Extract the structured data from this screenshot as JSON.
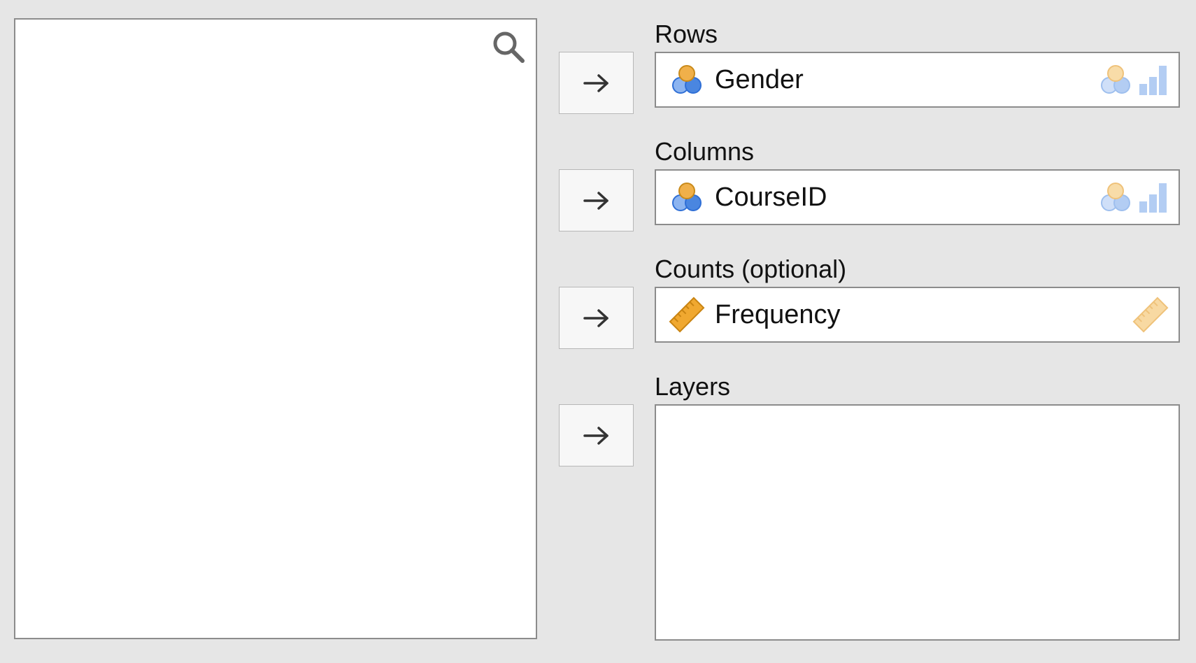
{
  "variable_list": {
    "search_icon": "search-icon"
  },
  "move_buttons": [
    {
      "icon": "arrow-right-icon"
    },
    {
      "icon": "arrow-right-icon"
    },
    {
      "icon": "arrow-right-icon"
    },
    {
      "icon": "arrow-right-icon"
    }
  ],
  "rows": {
    "label": "Rows",
    "variable": "Gender",
    "variable_icon": "nominal-icon",
    "accepts": [
      "nominal-icon",
      "ordinal-icon"
    ]
  },
  "columns": {
    "label": "Columns",
    "variable": "CourseID",
    "variable_icon": "nominal-icon",
    "accepts": [
      "nominal-icon",
      "ordinal-icon"
    ]
  },
  "counts": {
    "label": "Counts (optional)",
    "variable": "Frequency",
    "variable_icon": "continuous-icon",
    "accepts": [
      "continuous-icon"
    ]
  },
  "layers": {
    "label": "Layers"
  },
  "colors": {
    "background": "#e6e6e6",
    "nominal_orange": "#f0b04a",
    "nominal_blue": "#4a86e0",
    "ruler_orange": "#f0a830",
    "hint_faded": "#aac8f2"
  }
}
